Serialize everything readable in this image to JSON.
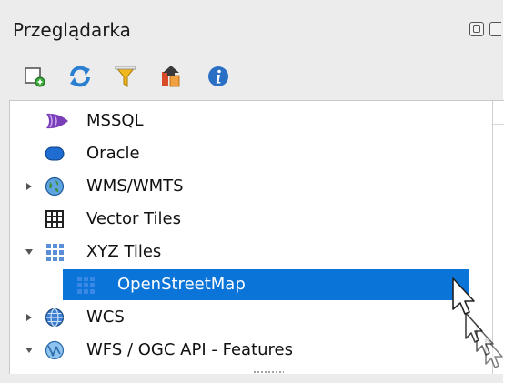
{
  "panel": {
    "title": "Przeglądarka"
  },
  "toolbar": {
    "buttons": [
      {
        "name": "add-layer-icon"
      },
      {
        "name": "refresh-icon"
      },
      {
        "name": "filter-icon"
      },
      {
        "name": "collapse-all-icon"
      },
      {
        "name": "info-icon"
      }
    ]
  },
  "tree": {
    "items": [
      {
        "label": "MSSQL",
        "icon": "mssql-icon",
        "expander": "none"
      },
      {
        "label": "Oracle",
        "icon": "oracle-icon",
        "expander": "none"
      },
      {
        "label": "WMS/WMTS",
        "icon": "wms-globe-icon",
        "expander": "collapsed"
      },
      {
        "label": "Vector Tiles",
        "icon": "vector-tiles-grid-icon",
        "expander": "none"
      },
      {
        "label": "XYZ Tiles",
        "icon": "xyz-tiles-grid-icon",
        "expander": "expanded"
      },
      {
        "label": "OpenStreetMap",
        "icon": "xyz-tile-layer-icon",
        "expander": "none",
        "selected": true,
        "child": true
      },
      {
        "label": "WCS",
        "icon": "wcs-globe-icon",
        "expander": "collapsed"
      },
      {
        "label": "WFS / OGC API - Features",
        "icon": "wfs-globe-icon",
        "expander": "expanded"
      }
    ]
  },
  "colors": {
    "selection": "#0a74d8",
    "panel_bg": "#ececec",
    "tree_bg": "#ffffff"
  }
}
